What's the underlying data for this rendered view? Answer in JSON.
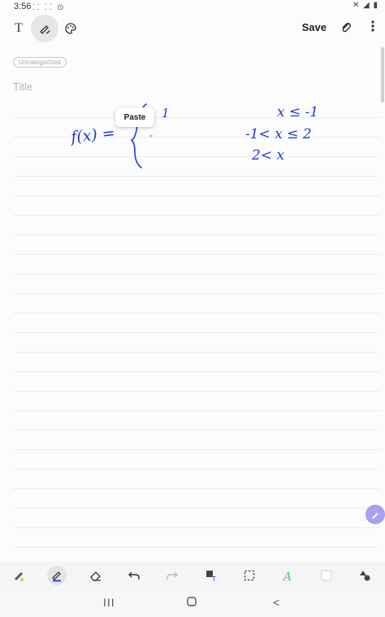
{
  "status": {
    "time": "3:56",
    "left_icons": "⸬ ⸬ ⊙",
    "right_icons": "✕ ◢ ▮"
  },
  "toolbar": {
    "text_tool_icon": "text-icon",
    "pen_tool_icon": "pen-mode-icon",
    "palette_icon": "palette-icon",
    "save_label": "Save",
    "attach_icon": "paperclip-icon",
    "more_icon": "more-icon"
  },
  "note": {
    "category": "Uncategorized",
    "title_placeholder": "Title"
  },
  "handwriting": {
    "lhs": "f(x) =",
    "case1_value": "1",
    "case1_condition": "x ≤ -1",
    "case2_condition": "-1< x ≤ 2",
    "case3_condition": "2< x"
  },
  "popup": {
    "paste_label": "Paste"
  },
  "bottom_tools": [
    "highlighter-pen-icon",
    "pen-icon",
    "eraser-icon",
    "undo-icon",
    "redo-icon",
    "text-convert-icon",
    "select-icon",
    "color-a-icon",
    "color-swatch-icon",
    "shapes-icon"
  ],
  "nav": {
    "recent": "III",
    "home": "O",
    "back": "<"
  },
  "colors": {
    "ink": "#1e3ad8",
    "accent": "#a7a0f3"
  }
}
